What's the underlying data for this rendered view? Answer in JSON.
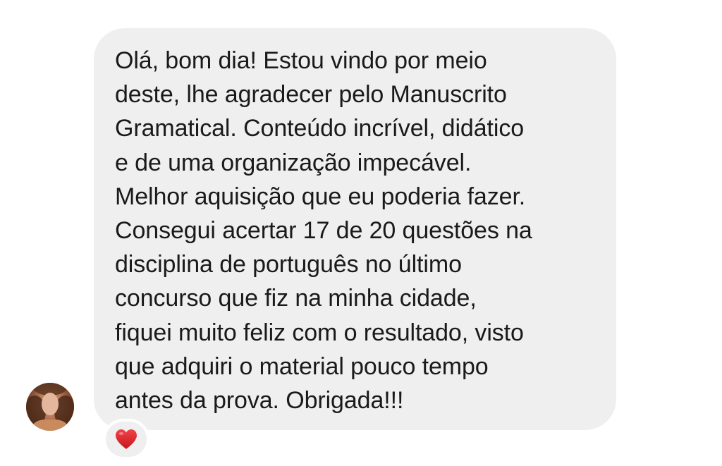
{
  "message": {
    "lines": [
      "Olá, bom dia! Estou vindo por meio",
      "deste, lhe agradecer pelo Manuscrito",
      "Gramatical. Conteúdo incrível, didático",
      "e de uma organização impecável.",
      "Melhor aquisição que eu poderia fazer.",
      "Consegui acertar 17 de 20 questões na",
      "disciplina de português no último",
      "concurso que fiz na minha cidade,",
      "fiquei muito feliz com o resultado, visto",
      "que adquiri o material pouco tempo",
      "antes da prova. Obrigada!!!"
    ],
    "bubble_color": "#efefef",
    "text_color": "#1a1a1a"
  },
  "reaction": {
    "icon": "heart-icon",
    "color": "#e0262d"
  },
  "avatar": {
    "icon": "avatar"
  }
}
